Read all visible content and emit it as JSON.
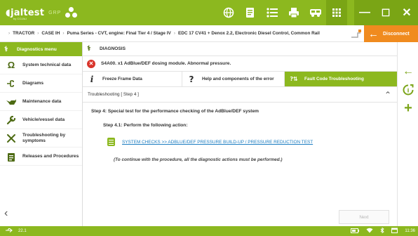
{
  "brand": {
    "logo": "jaltest",
    "sublogo": "by COJALI",
    "group": "GRP"
  },
  "topbar": {
    "icons": [
      "globe-icon",
      "document-list-icon",
      "list-icon",
      "printer-icon",
      "vehicle-icon",
      "camera-icon",
      "help-icon",
      "apps-grid-icon"
    ],
    "help_label": "?"
  },
  "window": {
    "minimize": "—",
    "maximize": "☐",
    "close": "✕"
  },
  "breadcrumb": {
    "items": [
      "TRACTOR",
      "CASE IH",
      "Puma Series - CVT, engine: Final Tier 4 / Stage IV",
      "EDC 17 CV41 + Denox 2.2, Electronic Diesel Control, Common Rail"
    ],
    "separator": "›"
  },
  "disconnect": {
    "label": "Disconnect",
    "arrow": "←"
  },
  "sidebar": {
    "header": "Diagnostics menu",
    "items": [
      {
        "label": "System technical data",
        "icon": "omega-icon"
      },
      {
        "label": "Diagrams",
        "icon": "diagram-icon"
      },
      {
        "label": "Maintenance data",
        "icon": "oil-can-icon"
      },
      {
        "label": "Vehicle/vessel data",
        "icon": "wrench-icon"
      },
      {
        "label": "Troubleshooting by symptoms",
        "icon": "tools-icon"
      },
      {
        "label": "Releases and Procedures",
        "icon": "clipboard-icon"
      }
    ],
    "back": "‹"
  },
  "main": {
    "title": "DIAGNOSIS",
    "error": {
      "text": "S4A00. x1 AdBlue/DEF dosing module. Abnormal pressure.",
      "icon_glyph": "✕"
    },
    "tabs": [
      {
        "label": "Freeze Frame Data",
        "glyph": "i"
      },
      {
        "label": "Help and components of the error",
        "glyph": "?"
      },
      {
        "label": "Fault Code Troubleshooting",
        "glyph": "?⇅"
      }
    ],
    "step_bar": "Troubleshooting [ Step 4 ]",
    "collapse": "⌃",
    "step_title": "Step 4: Special test for the performance checking of the AdBlue/DEF system",
    "sub_step": "Step 4.1: Perform the following action:",
    "link": "SYSTEM CHECKS >> ADBLUE/DEF PRESSURE BUILD-UP / PRESSURE REDUCTION TEST",
    "note": "(To continue with the procedure, all the diagnostic actions must be performed.)",
    "next": "Next"
  },
  "rail": {
    "back": "←",
    "plus": "+"
  },
  "status": {
    "version": "22.1",
    "time": "11:36"
  },
  "colors": {
    "brand_green": "#8cb81f",
    "disconnect_orange": "#f08b1f",
    "error_red": "#d9342b",
    "link_blue": "#1a7cc1"
  }
}
